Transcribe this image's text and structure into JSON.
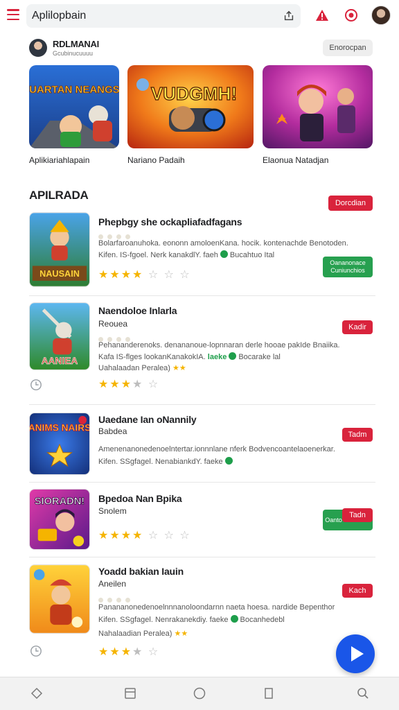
{
  "search": {
    "value": "Aplilopbain"
  },
  "icons": {
    "menu": "hamburger-menu-icon",
    "share": "share-icon",
    "alert": "alert-warning-icon",
    "target": "target-icon",
    "clock": "clock-icon",
    "play": "play-icon"
  },
  "colors": {
    "accent_red": "#d9233c",
    "green": "#27a04f",
    "blue_fab": "#1a56e8",
    "star": "#f5b400"
  },
  "publisher": {
    "name": "RDLMANAI",
    "subtitle": "Gcubinucuuuu",
    "follow_label": "Enorocpan"
  },
  "featured": [
    {
      "label": "Aplikiariahlapain",
      "art_text": "QUARTAN NEANGSH"
    },
    {
      "label": "Nariano Padaih",
      "art_text": "VUDGMH!"
    },
    {
      "label": "Elaonua Natadjan",
      "art_text": ""
    }
  ],
  "section": {
    "title": "APILRADA",
    "button_label": "Dorcdian"
  },
  "apps": [
    {
      "title": "Phepbgy she ockapliafadfagans",
      "subtitle": "",
      "desc_line1": "Bolarfaroanuhoka. eononn amoloenKana. hocik. kontenachde Benotoden.",
      "desc_line2_pre": "Kifen. IS-fgoel. Nerk kanakdlY. faeh",
      "desc_line2_post": "Bucahtuo Ital",
      "desc_line3": "",
      "rating": 3.5,
      "stars_on": "★★★★",
      "stars_off": "☆ ☆ ☆",
      "art_text": "NAUSAIN",
      "button_label": "Oananonace Cuniunchios"
    },
    {
      "title": "Naendoloe Inlarla",
      "subtitle": "Reouea",
      "desc_line1": "Pehananderenoks. denananoue-lopnnaran derle hooae pakIde Bnaiika.",
      "desc_line2_pre": "Kafa IS-flges lookanKanakokIA.",
      "desc_line2_green": "laeke",
      "desc_line2_post": "Bocarake lal",
      "desc_line3": "Uahalaadan Peralea)",
      "rating": 3,
      "stars_on": "★★★",
      "stars_off": "★ ☆",
      "art_text": "AANIEA",
      "button_label": "Kadir"
    },
    {
      "title": "Uaedane Ian oNannily",
      "subtitle": "Babdea",
      "desc_line1": "Amenenanonedenoelntertar.ionnnlane nferk Bodvencoantelaoenerkar.",
      "desc_line2_pre": "Kifen. SSgfagel. NenabiankdY. faeke",
      "desc_line2_post": "",
      "desc_line3": "",
      "rating": 0,
      "stars_on": "",
      "stars_off": "",
      "art_text": "ANIMS NAIRS",
      "button_label": "Tadm"
    },
    {
      "title": "Bpedoa Nan Bpika",
      "subtitle": "Snolem",
      "desc_line1": "",
      "desc_line2_pre": "",
      "desc_line2_post": "",
      "desc_line3": "",
      "rating": 3.5,
      "stars_on": "★★★★",
      "stars_off": "☆ ☆ ☆",
      "art_text": "SIORADN!",
      "button_label": "Tadn",
      "button2_label": "Oanto Conunkto"
    },
    {
      "title": "Yoadd bakian Iauin",
      "subtitle": "Aneilen",
      "desc_line1": "Panananonedenoelnnnanoloondarnn naeta hoesa. nardide Bepenthor",
      "desc_line2_pre": "Kifen. SSgfagel. Nenrakanekdiy. faeke",
      "desc_line2_post": "Bocanhedebl",
      "desc_line3": "Nahalaadian Peralea)",
      "rating": 3,
      "stars_on": "★★★",
      "stars_off": "★ ☆",
      "art_text": "",
      "button_label": "Kach"
    }
  ]
}
